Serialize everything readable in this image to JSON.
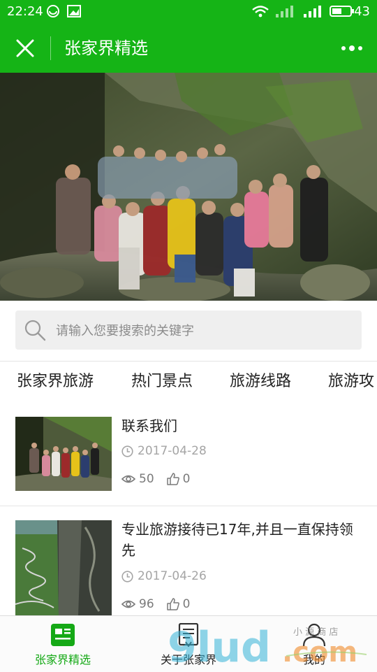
{
  "status_bar": {
    "time": "22:24",
    "battery": "43",
    "icons": [
      "wechat-bubble-icon",
      "image-icon",
      "wifi-icon",
      "signal-icon",
      "signal-4g-icon",
      "battery-icon"
    ]
  },
  "header": {
    "title": "张家界精选",
    "close_icon": "close-icon",
    "more_icon": "more-dots-icon",
    "background": "#15b416"
  },
  "search": {
    "placeholder": "请输入您要搜索的关键字",
    "value": ""
  },
  "tabs": [
    {
      "label": "张家界旅游"
    },
    {
      "label": "热门景点"
    },
    {
      "label": "旅游线路"
    },
    {
      "label": "旅游攻"
    }
  ],
  "articles": [
    {
      "title": "联系我们",
      "date": "2017-04-28",
      "views": "50",
      "likes": "0"
    },
    {
      "title": "专业旅游接待已17年,并且一直保持领先",
      "date": "2017-04-26",
      "views": "96",
      "likes": "0"
    }
  ],
  "bottom_nav": [
    {
      "label": "张家界精选",
      "icon": "article-list-icon",
      "active": true
    },
    {
      "label": "关于张家界",
      "icon": "document-icon",
      "active": false
    },
    {
      "label": "我的",
      "icon": "user-icon",
      "active": false
    }
  ],
  "watermark": {
    "text": "9lud.com",
    "small_text": "小 源 商 店"
  },
  "colors": {
    "accent": "#15b416",
    "active_nav": "#15a916",
    "muted_text": "#a5a5a5"
  }
}
